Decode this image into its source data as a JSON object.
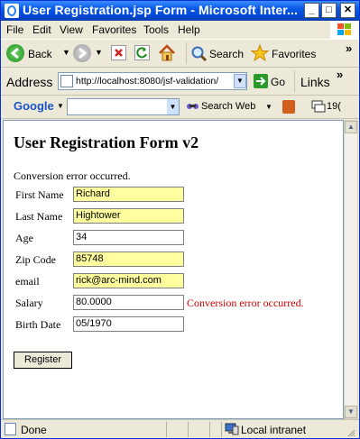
{
  "window": {
    "title": "User Registration.jsp Form - Microsoft Inter...",
    "buttons": {
      "minimize": "_",
      "maximize": "□",
      "close": "✕"
    }
  },
  "menu": {
    "items": [
      {
        "label": "File"
      },
      {
        "label": "Edit"
      },
      {
        "label": "View"
      },
      {
        "label": "Favorites"
      },
      {
        "label": "Tools"
      },
      {
        "label": "Help"
      }
    ]
  },
  "toolbar": {
    "back_label": "Back",
    "search_label": "Search",
    "favorites_label": "Favorites",
    "more_glyph": "»"
  },
  "address": {
    "label": "Address",
    "url": "http://localhost:8080/jsf-validation/",
    "go_label": "Go",
    "links_label": "Links",
    "more_glyph": "»"
  },
  "google": {
    "logo": "Google",
    "search_value": "",
    "search_web_label": "Search Web",
    "counter": "19("
  },
  "page": {
    "heading": "User Registration Form v2",
    "error_summary": "Conversion error occurred.",
    "fields": [
      {
        "label": "First Name",
        "value": "Richard"
      },
      {
        "label": "Last Name",
        "value": "Hightower"
      },
      {
        "label": "Age",
        "value": "34"
      },
      {
        "label": "Zip Code",
        "value": "85748"
      },
      {
        "label": "email",
        "value": "rick@arc-mind.com"
      },
      {
        "label": "Salary",
        "value": "80.0000",
        "error": "Conversion error occurred."
      },
      {
        "label": "Birth Date",
        "value": "05/1970"
      }
    ],
    "submit_label": "Register"
  },
  "status": {
    "text": "Done",
    "zone": "Local intranet"
  },
  "colors": {
    "title_bar": "#0a58e6",
    "field_highlight": "#ffffa0",
    "error_text": "#cc0000"
  }
}
